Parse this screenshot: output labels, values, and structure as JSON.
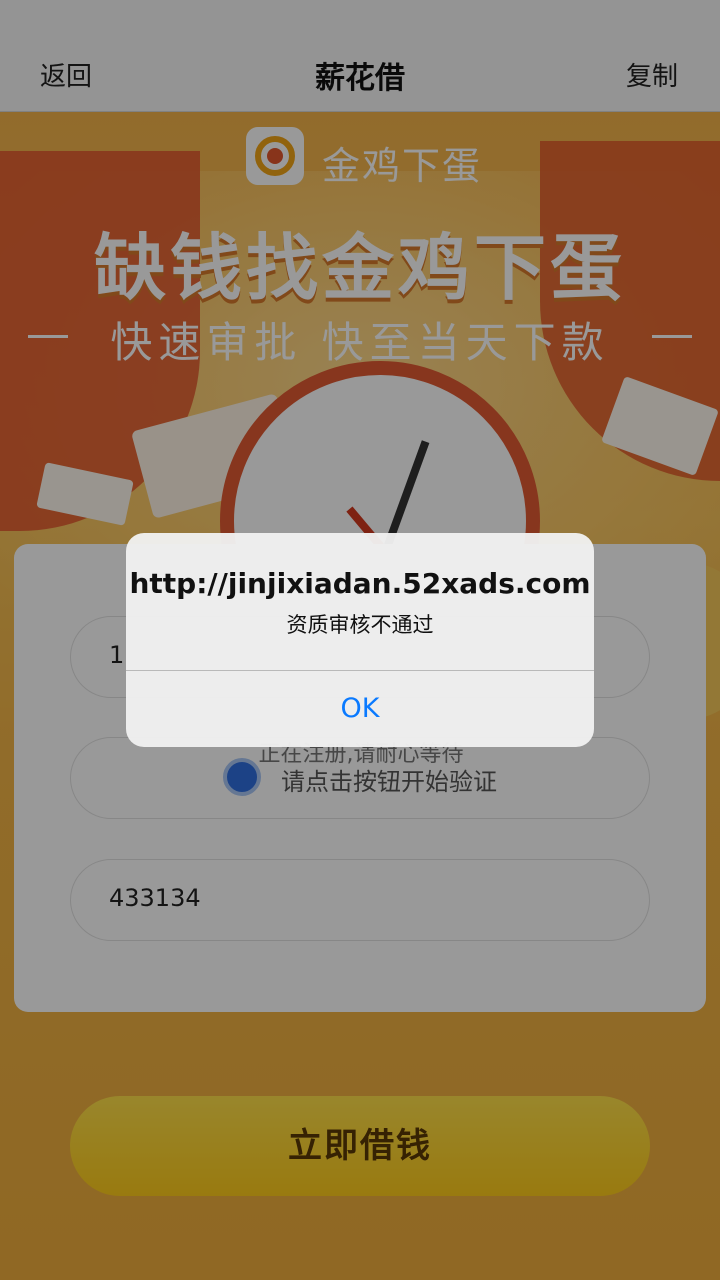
{
  "nav": {
    "back_label": "返回",
    "title": "薪花借",
    "copy_label": "复制"
  },
  "banner": {
    "brand_name": "金鸡下蛋",
    "slogan": "缺钱找金鸡下蛋",
    "subslogan": "快速审批 快至当天下款"
  },
  "form": {
    "phone_value": "1",
    "verify_status": "正在注册,请耐心等待",
    "verify_hint": "请点击按钮开始验证",
    "code_value": "433134",
    "submit_label": "立即借钱"
  },
  "alert": {
    "title": "http://jinjixiadan.52xads.com",
    "message": "资质审核不通过",
    "ok_label": "OK"
  },
  "colors": {
    "accent_blue": "#0a7aff",
    "button_yellow": "#ffd52a",
    "brand_orange": "#f2a516"
  }
}
